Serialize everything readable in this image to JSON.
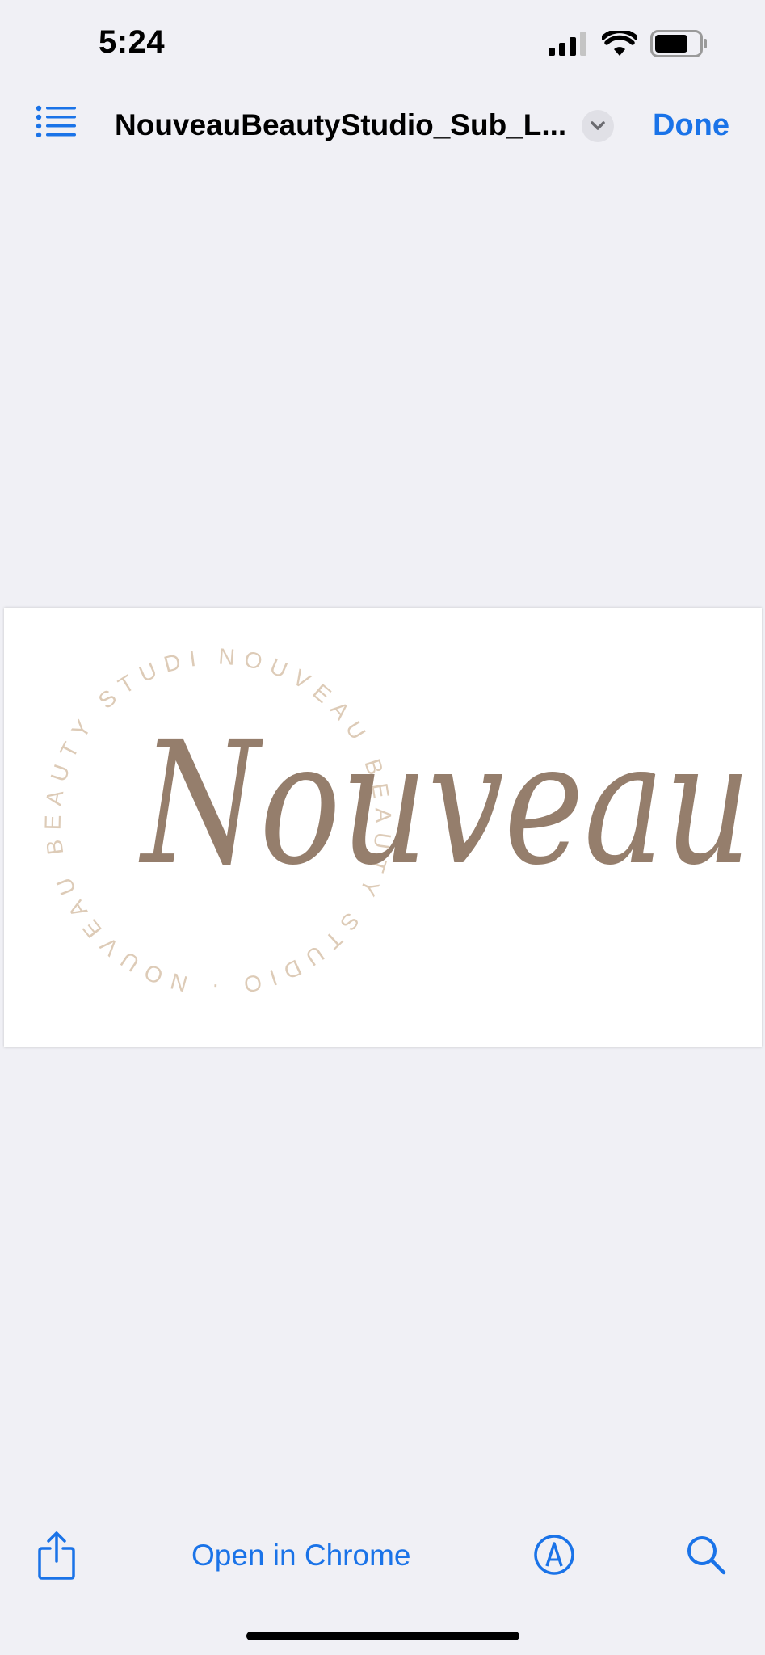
{
  "status_bar": {
    "time": "5:24"
  },
  "nav": {
    "title": "NouveauBeautyStudio_Sub_L...",
    "done_label": "Done",
    "icons": [
      "list-icon",
      "chevron-down-icon"
    ]
  },
  "document": {
    "logo_script": "Nouveau",
    "logo_ring_text": "NOUVEAU BEAUTY STUDIO · NOUVEAU BEAUTY STUDIO ·"
  },
  "toolbar": {
    "open_in_label": "Open in Chrome",
    "icons": [
      "share-icon",
      "markup-icon",
      "search-icon"
    ]
  },
  "colors": {
    "accent": "#1a73e8",
    "background": "#f0f0f5",
    "logo_script": "#957e6c",
    "logo_ring": "#ddcbb7"
  }
}
